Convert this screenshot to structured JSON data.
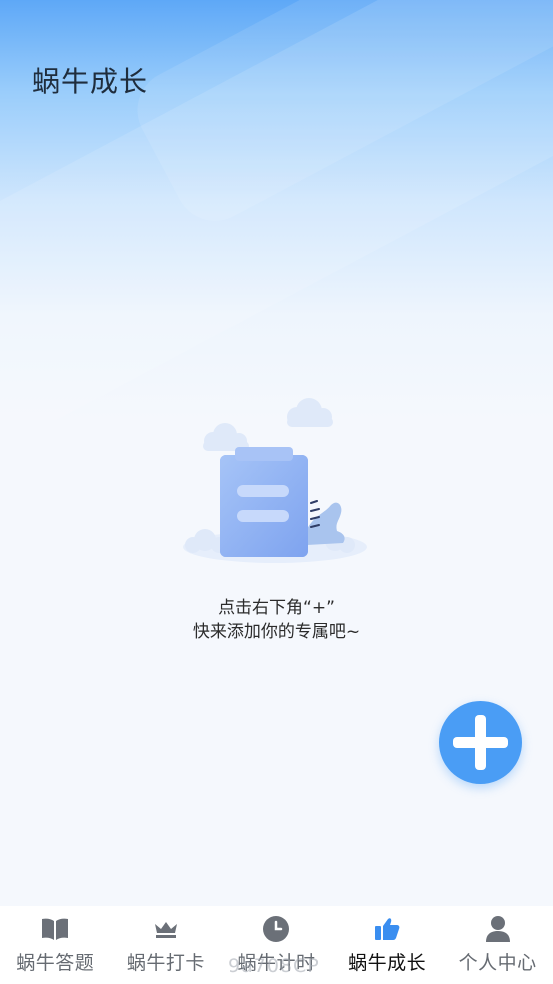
{
  "header": {
    "title": "蜗牛成长"
  },
  "empty_state": {
    "illustration": "clipboard-with-clouds",
    "line1": "点击右下角“+”",
    "line2": "快来添加你的专属吧~"
  },
  "fab": {
    "icon": "plus-icon",
    "color": "#4a9df5"
  },
  "tabbar": {
    "active_index": 3,
    "active_color": "#3a8ef0",
    "inactive_color": "#666b72",
    "items": [
      {
        "label": "蜗牛答题",
        "icon": "book-icon"
      },
      {
        "label": "蜗牛打卡",
        "icon": "crown-icon"
      },
      {
        "label": "蜗牛计时",
        "icon": "clock-icon"
      },
      {
        "label": "蜗牛成长",
        "icon": "thumbs-up-icon"
      },
      {
        "label": "个人中心",
        "icon": "person-icon"
      }
    ]
  },
  "watermark": {
    "text": "9a708CP"
  }
}
